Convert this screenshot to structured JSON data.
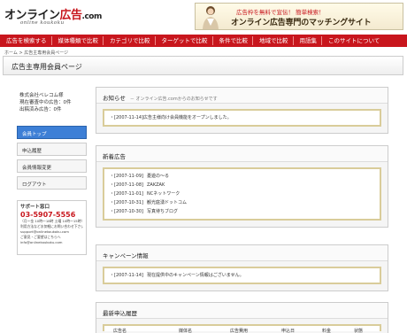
{
  "header": {
    "logo_main_a": "オンライン",
    "logo_main_b": "広告",
    "logo_main_c": ".com",
    "logo_sub": "online koukoku",
    "banner_line1": "広告枠を無料で宣伝！ 簡単検索！",
    "banner_line2": "オンライン広告専門のマッチングサイト"
  },
  "nav": {
    "items": [
      "広告を検索する",
      "媒体種類で比較",
      "カテゴリで比較",
      "ターゲットで比較",
      "条件で比較",
      "地域で比較",
      "用語集",
      "このサイトについて"
    ]
  },
  "breadcrumb": "ホーム > 広告主専用会員ページ",
  "page_title": "広告主専用会員ページ",
  "account": {
    "company": "株式会社ベレコム様",
    "applying": "現在審査中の広告：0件",
    "published": "出稿済み広告：0件"
  },
  "side_menu": {
    "items": [
      "会員トップ",
      "申込履歴",
      "会員情報変更",
      "ログアウト"
    ]
  },
  "support": {
    "title": "サポート窓口",
    "phone": "03-5907-5556",
    "hours": "（月〜金 10時〜18時 土曜 10時〜15時）",
    "note": "利用方法などお気軽にお問い合わせ下さい。",
    "email1": "support@onlinekoukoku.com",
    "mail_note": "ご意見・ご要望はこちらへ",
    "email2": "info@onlinekoukoku.com"
  },
  "notice": {
    "title": "お知らせ",
    "subtitle": "－ オンライン広告.comからのお知らせです",
    "items": [
      {
        "date": "[2007-11-14]",
        "text": "広告主様向け会員機能をオープンしました。"
      }
    ]
  },
  "new_ads": {
    "title": "新着広告",
    "items": [
      {
        "date": "[2007-11-09]",
        "text": "憂遊の〜る"
      },
      {
        "date": "[2007-11-08]",
        "text": "ZAKZAK"
      },
      {
        "date": "[2007-11-01]",
        "text": "NCネットワーク"
      },
      {
        "date": "[2007-10-31]",
        "text": "観光庭湧ドットコム"
      },
      {
        "date": "[2007-10-30]",
        "text": "写真待ちブログ"
      }
    ]
  },
  "campaign": {
    "title": "キャンペーン情報",
    "items": [
      {
        "date": "[2007-11-14]",
        "text": "現在提供中のキャンペーン情報はございません。"
      }
    ]
  },
  "history": {
    "title": "最新申込履歴",
    "columns": [
      "広告名",
      "媒体名",
      "広告費用",
      "申込日",
      "料金",
      "状態"
    ]
  }
}
